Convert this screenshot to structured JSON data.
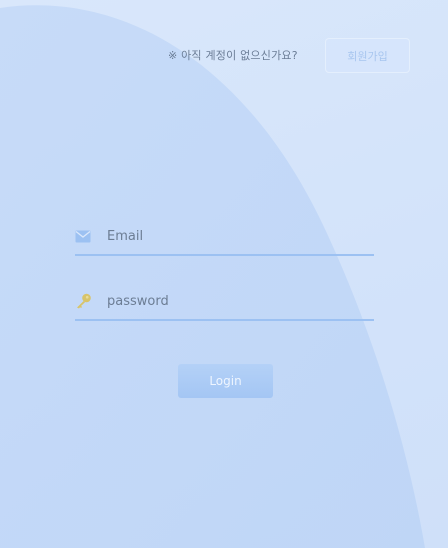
{
  "header": {
    "signup_prompt": "※ 아직 계정이 없으신가요?",
    "signup_button_label": "회원가입"
  },
  "form": {
    "email_placeholder": "Email",
    "email_value": "",
    "password_placeholder": "password",
    "password_value": "",
    "login_button_label": "Login"
  },
  "icons": {
    "email": "envelope-icon",
    "password": "key-icon"
  },
  "colors": {
    "background": "#d6e5fa",
    "accent": "#a4c6f4",
    "underline": "#9cc1f2",
    "key_icon": "#d8c46a"
  }
}
